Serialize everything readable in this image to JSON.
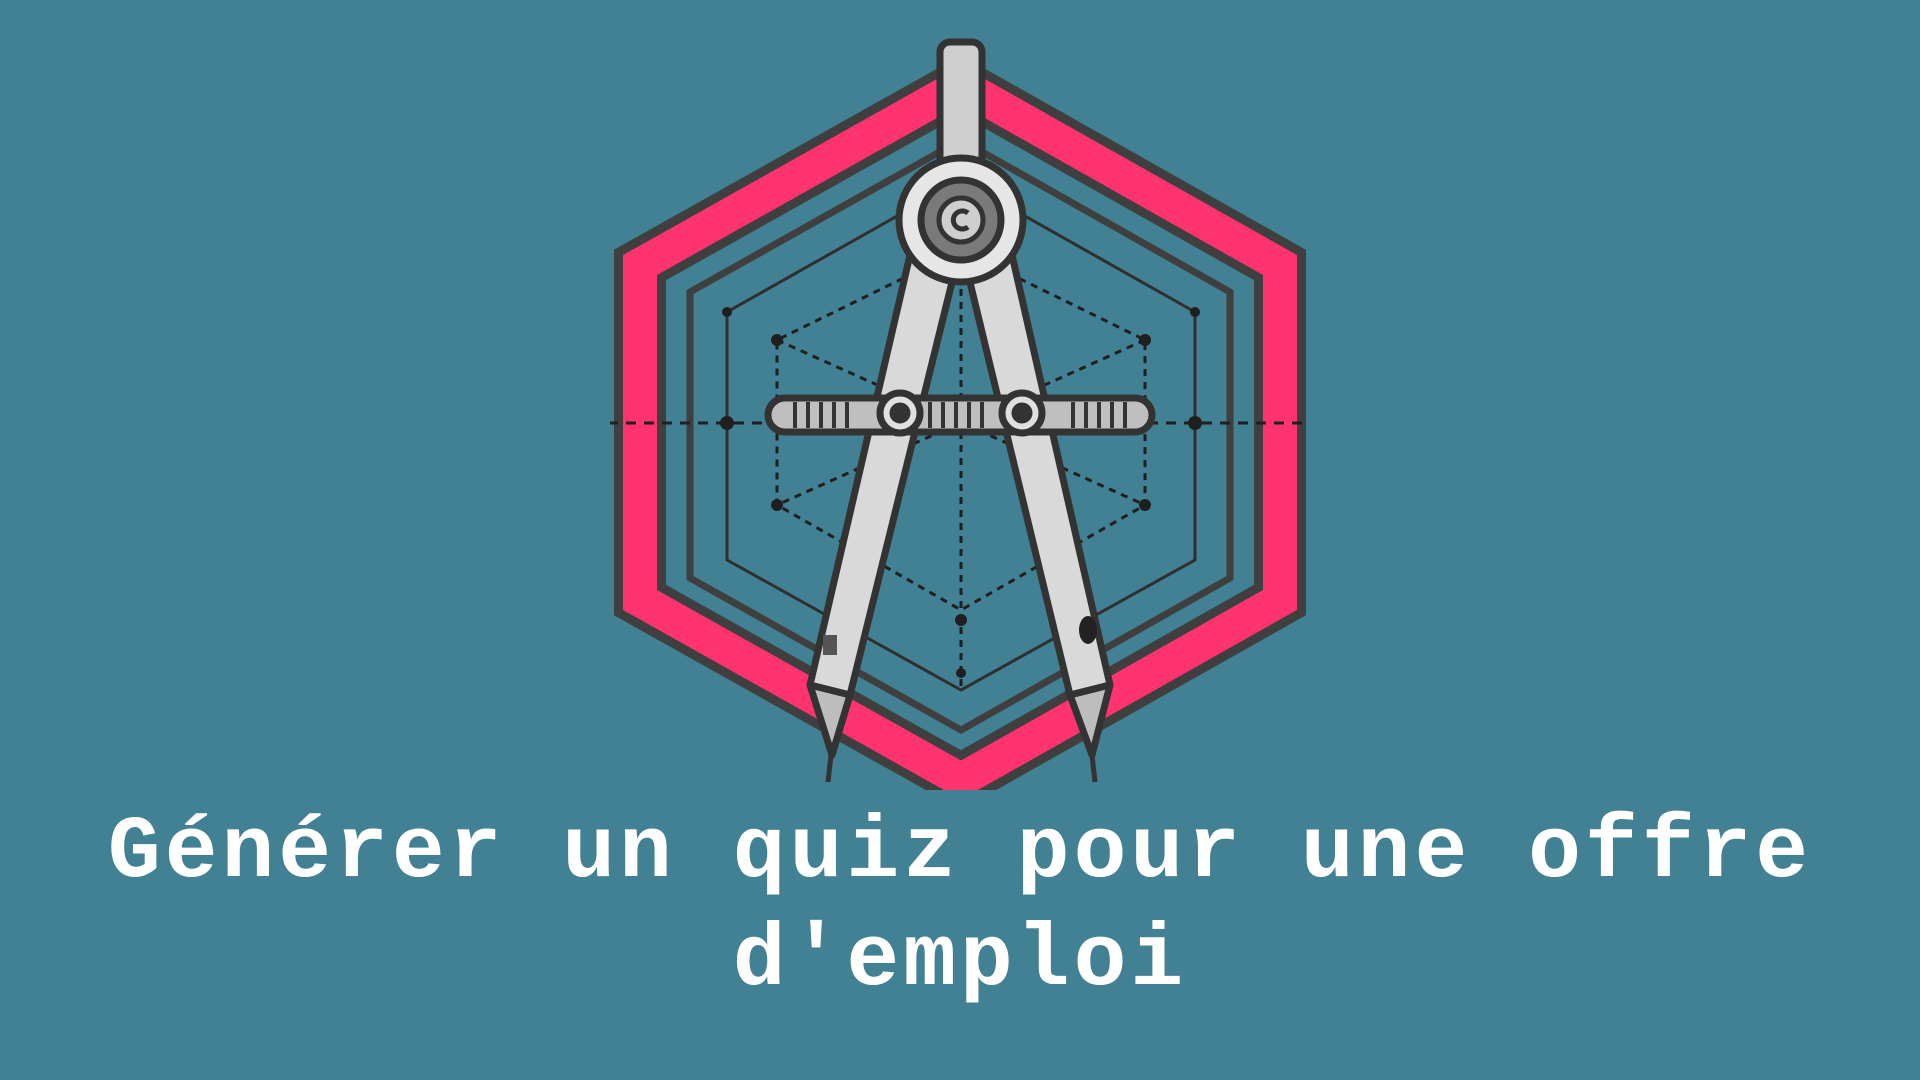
{
  "background_color": "#428193",
  "accent_color": "#ff3370",
  "outline_color": "#3f3f3f",
  "logo": {
    "icon": "drafting-compass-hexagon-icon"
  },
  "title": {
    "line1": "Générer un quiz pour une offre",
    "line2": "d'emploi"
  }
}
